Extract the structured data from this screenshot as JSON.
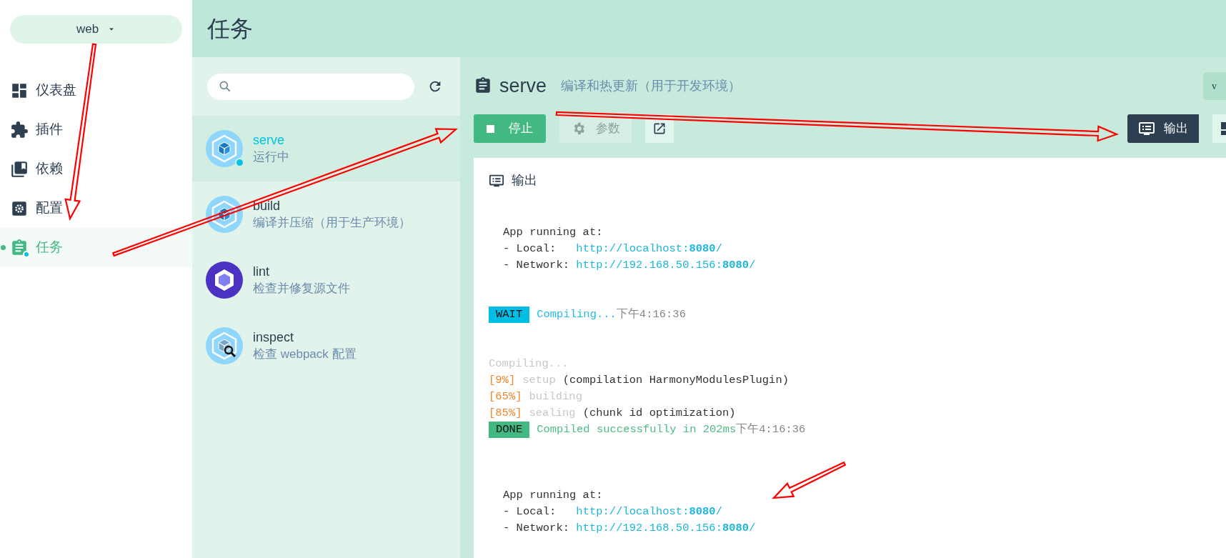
{
  "project_selector": {
    "label": "web"
  },
  "nav": [
    {
      "label": "仪表盘",
      "kind": "dashboard",
      "selected": false
    },
    {
      "label": "插件",
      "kind": "plugin",
      "selected": false
    },
    {
      "label": "依赖",
      "kind": "dependency",
      "selected": false
    },
    {
      "label": "配置",
      "kind": "config",
      "selected": false
    },
    {
      "label": "任务",
      "kind": "task",
      "selected": true
    }
  ],
  "header": {
    "title": "任务"
  },
  "task_list": {
    "tasks": [
      {
        "name": "serve",
        "description": "运行中",
        "kind": "webpack",
        "selected": true,
        "running": true
      },
      {
        "name": "build",
        "description": "编译并压缩（用于生产环境）",
        "kind": "webpack",
        "selected": false,
        "running": false
      },
      {
        "name": "lint",
        "description": "检查并修复源文件",
        "kind": "eslint",
        "selected": false,
        "running": false
      },
      {
        "name": "inspect",
        "description": "检查 webpack 配置",
        "kind": "inspect",
        "selected": false,
        "running": false
      }
    ]
  },
  "task_detail": {
    "name": "serve",
    "description": "编译和热更新（用于开发环境）",
    "corner_button": "v",
    "actions": [
      {
        "kind": "stop",
        "label": "停止"
      },
      {
        "kind": "params",
        "label": "参数",
        "disabled": true
      },
      {
        "kind": "open"
      }
    ],
    "views": [
      {
        "kind": "output",
        "label": "输出",
        "selected": true
      },
      {
        "kind": "dashboard",
        "selected": false
      }
    ],
    "output": {
      "title": "输出",
      "blocks": [
        {
          "kind": "address",
          "lines": [
            [
              {
                "kind": "plain",
                "text": "App running at:"
              }
            ],
            [
              {
                "kind": "plain",
                "text": "- Local:   "
              },
              {
                "kind": "link",
                "text": "http://localhost:**8080**/"
              }
            ],
            [
              {
                "kind": "plain",
                "text": "- Network: "
              },
              {
                "kind": "link",
                "text": "http://192.168.50.156:**8080**/"
              }
            ]
          ]
        },
        {
          "kind": "status",
          "lines": [
            [
              {
                "kind": "badge_wait",
                "text": "WAIT"
              },
              {
                "kind": "info",
                "text": "Compiling..."
              },
              {
                "kind": "time",
                "text": "下午4:16:36"
              }
            ]
          ]
        },
        {
          "kind": "progress",
          "lines": [
            [
              {
                "kind": "faint",
                "text": "Compiling..."
              }
            ],
            [
              {
                "kind": "percent",
                "text": "[9%]"
              },
              {
                "kind": "faint",
                "text": "setup"
              },
              {
                "kind": "plain",
                "text": "(compilation HarmonyModulesPlugin)"
              }
            ],
            [
              {
                "kind": "percent",
                "text": "[65%]"
              },
              {
                "kind": "faint",
                "text": "building"
              }
            ],
            [
              {
                "kind": "percent",
                "text": "[85%]"
              },
              {
                "kind": "faint",
                "text": "sealing"
              },
              {
                "kind": "plain",
                "text": "(chunk id optimization)"
              }
            ],
            [
              {
                "kind": "badge_done",
                "text": "DONE"
              },
              {
                "kind": "success",
                "text": "Compiled successfully in 202ms"
              },
              {
                "kind": "time",
                "text": "下午4:16:36"
              }
            ]
          ]
        },
        {
          "kind": "address",
          "lines": [
            [
              {
                "kind": "plain",
                "text": "App running at:"
              }
            ],
            [
              {
                "kind": "plain",
                "text": "- Local:   "
              },
              {
                "kind": "link",
                "text": "http://localhost:**8080**/"
              }
            ],
            [
              {
                "kind": "plain",
                "text": "- Network: "
              },
              {
                "kind": "link",
                "text": "http://192.168.50.156:**8080**/"
              }
            ]
          ]
        }
      ]
    }
  }
}
